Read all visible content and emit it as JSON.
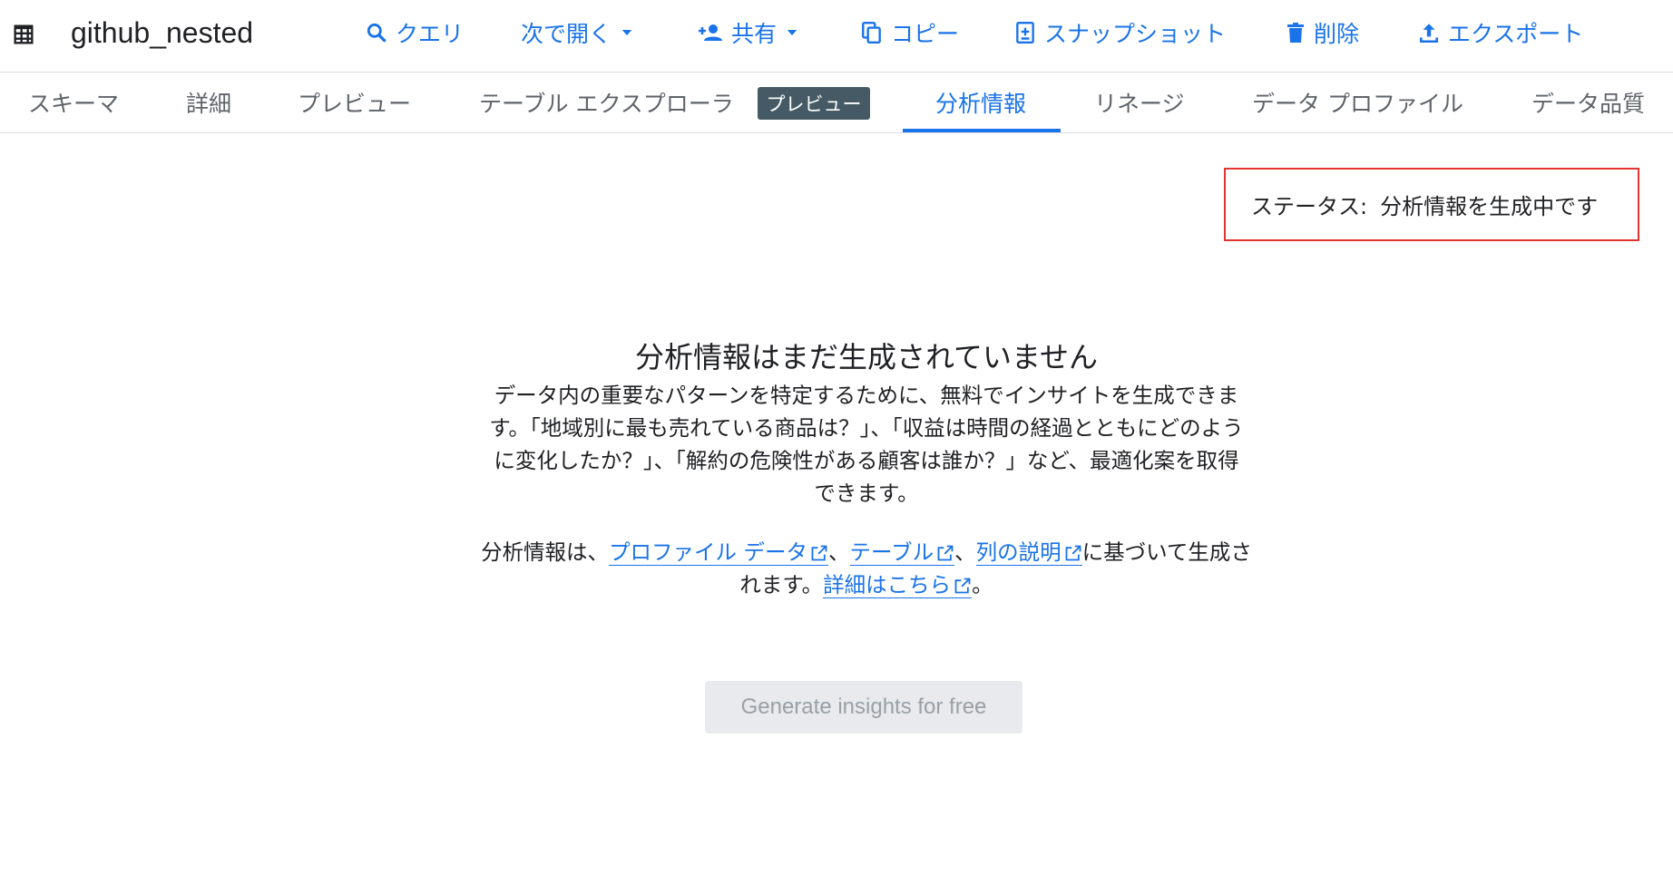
{
  "header": {
    "title": "github_nested",
    "actions": {
      "query": "クエリ",
      "open_in": "次で開く",
      "share": "共有",
      "copy": "コピー",
      "snapshot": "スナップショット",
      "delete": "削除",
      "export": "エクスポート"
    }
  },
  "tabs": {
    "schema": "スキーマ",
    "details": "詳細",
    "preview": "プレビュー",
    "table_explorer": "テーブル エクスプローラ",
    "table_explorer_badge": "プレビュー",
    "insights": "分析情報",
    "lineage": "リネージ",
    "data_profile": "データ プロファイル",
    "data_quality": "データ品質"
  },
  "status": {
    "label": "ステータス:",
    "value": "分析情報を生成中です"
  },
  "empty_state": {
    "heading": "分析情報はまだ生成されていません",
    "description": "データ内の重要なパターンを特定するために、無料でインサイトを生成できます。「地域別に最も売れている商品は？」、「収益は時間の経過とともにどのように変化したか？」、「解約の危険性がある顧客は誰か？」など、最適化案を取得できます。",
    "note_prefix": "分析情報は、",
    "link_profile": "プロファイル データ",
    "sep1": "、",
    "link_table": "テーブル",
    "sep2": "、",
    "link_columns": "列の説明",
    "note_middle": "に基づいて生成されます。",
    "link_learn_more": "詳細はこちら",
    "note_end": "。",
    "button_label": "Generate insights for free"
  },
  "colors": {
    "accent": "#1a73e8",
    "status_border": "#e3342f",
    "badge_bg": "#455a64"
  }
}
